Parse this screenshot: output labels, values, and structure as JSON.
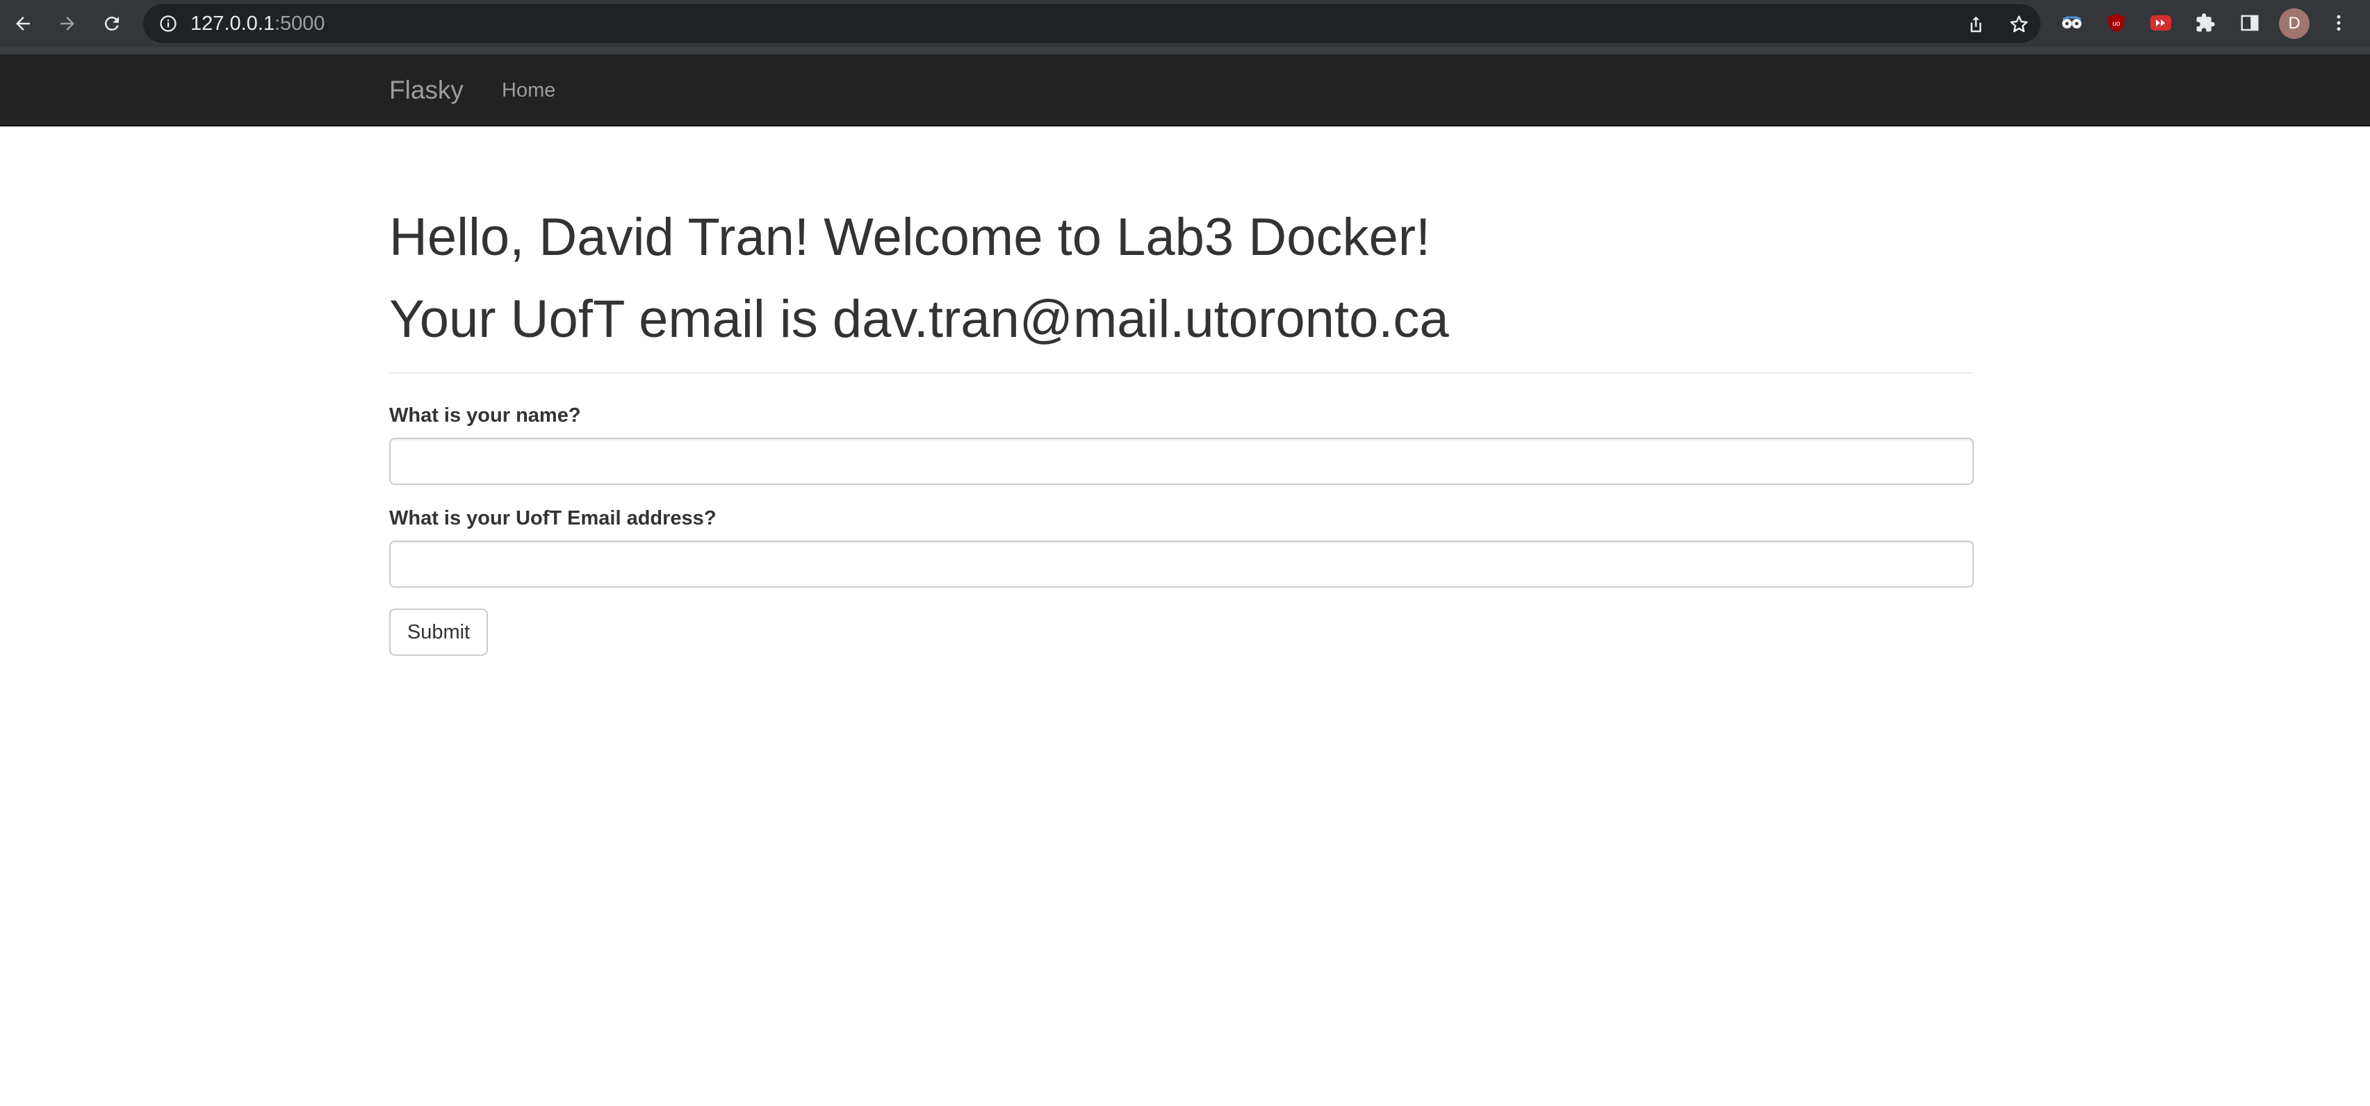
{
  "browser": {
    "url_host": "127.0.0.1",
    "url_port": ":5000",
    "profile_initial": "D",
    "icons": {
      "back": "arrow-left-icon",
      "forward": "arrow-right-icon",
      "reload": "reload-icon",
      "site_info": "info-icon",
      "share": "share-icon",
      "bookmark": "star-icon",
      "extensions": "puzzle-icon",
      "side_panel": "side-panel-icon",
      "menu": "kebab-menu-icon"
    }
  },
  "navbar": {
    "brand": "Flasky",
    "links": [
      "Home"
    ]
  },
  "main": {
    "heading_greeting": "Hello, David Tran! Welcome to Lab3 Docker!",
    "heading_email": "Your UofT email is dav.tran@mail.utoronto.ca",
    "form": {
      "name_label": "What is your name?",
      "name_value": "",
      "email_label": "What is your UofT Email address?",
      "email_value": "",
      "submit_label": "Submit"
    }
  },
  "colors": {
    "browser_toolbar": "#35363a",
    "omnibox": "#202124",
    "navbar_bg": "#222222",
    "navbar_text": "#9d9d9d",
    "heading_text": "#333333",
    "input_border": "#cccccc"
  }
}
